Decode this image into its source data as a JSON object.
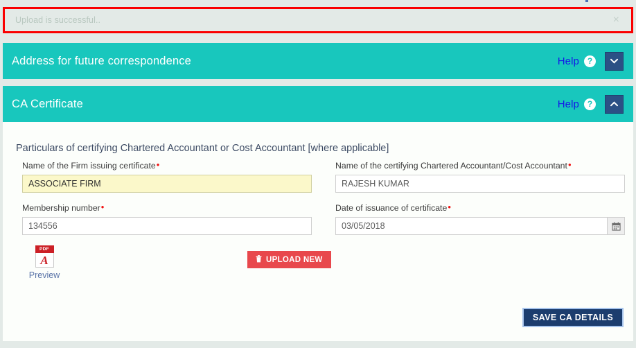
{
  "alert": {
    "message": "Upload is successful..",
    "close_label": "×"
  },
  "panels": [
    {
      "title": "Address for future correspondence",
      "help_label": "Help",
      "help_badge": "?",
      "toggle_icon": "chevron-down-icon",
      "expanded": false
    },
    {
      "title": "CA Certificate",
      "help_label": "Help",
      "help_badge": "?",
      "toggle_icon": "chevron-up-icon",
      "expanded": true
    }
  ],
  "ca_section": {
    "heading": "Particulars of certifying Chartered Accountant or Cost Accountant [where applicable]",
    "fields": {
      "firm_name": {
        "label": "Name of the Firm issuing certificate",
        "required_marker": "•",
        "value": "ASSOCIATE FIRM"
      },
      "ca_name": {
        "label": "Name of the certifying Chartered Accountant/Cost Accountant",
        "required_marker": "•",
        "value": "RAJESH KUMAR"
      },
      "membership_number": {
        "label": "Membership number",
        "required_marker": "•",
        "value": "134556"
      },
      "issue_date": {
        "label": "Date of issuance of certificate",
        "required_marker": "•",
        "value": "03/05/2018",
        "picker_icon": "calendar-icon"
      }
    },
    "attachment": {
      "file_type_label": "PDF",
      "file_glyph": "A",
      "preview_label": "Preview",
      "upload_button_label": "UPLOAD NEW",
      "upload_button_icon": "trash-icon"
    },
    "save_button_label": "SAVE CA DETAILS"
  },
  "colors": {
    "teal": "#18c7bd",
    "alert_border": "#fa0000",
    "page_background": "#e3eae7",
    "help_link": "#1417e8",
    "toggle_button": "#2b5085",
    "upload_red": "#e8484c",
    "save_navy": "#1c3d6e",
    "autofill_yellow": "#fbf8ca",
    "required_red": "#f11010"
  }
}
